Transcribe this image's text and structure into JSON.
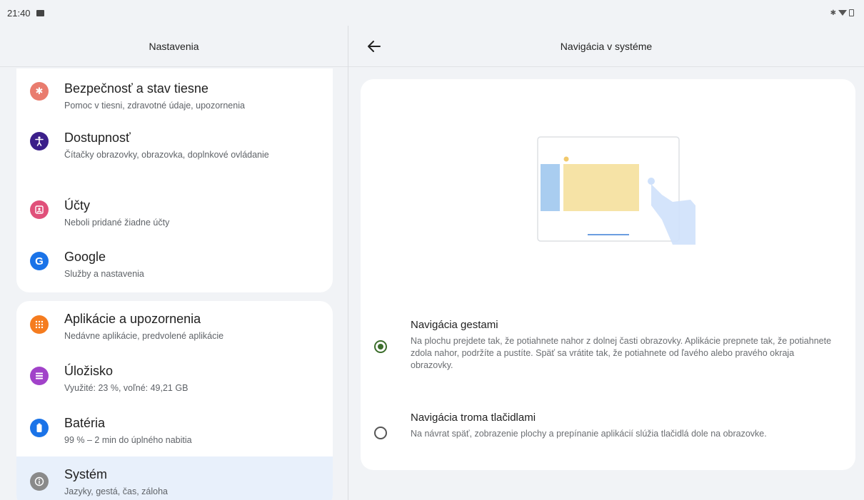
{
  "status_bar": {
    "time": "21:40"
  },
  "left": {
    "header": "Nastavenia",
    "items": [
      {
        "title": "Bezpečnosť a stav tiesne",
        "subtitle": "Pomoc v tiesni, zdravotné údaje, upozornenia",
        "icon": "emergency-icon",
        "color": "#e97c6e"
      },
      {
        "title": "Dostupnosť",
        "subtitle": "Čítačky obrazovky, obrazovka, doplnkové ovládanie",
        "icon": "accessibility-icon",
        "color": "#3b1f8a"
      },
      {
        "title": "Účty",
        "subtitle": "Neboli pridané žiadne účty",
        "icon": "accounts-icon",
        "color": "#e0507a"
      },
      {
        "title": "Google",
        "subtitle": "Služby a nastavenia",
        "icon": "google-icon",
        "color": "#1a73e8"
      },
      {
        "title": "Aplikácie a upozornenia",
        "subtitle": "Nedávne aplikácie, predvolené aplikácie",
        "icon": "apps-icon",
        "color": "#f57c1f"
      },
      {
        "title": "Úložisko",
        "subtitle": "Využité: 23 %, voľné: 49,21 GB",
        "icon": "storage-icon",
        "color": "#a142c9"
      },
      {
        "title": "Batéria",
        "subtitle": "99 % – 2 min do úplného nabitia",
        "icon": "battery-icon",
        "color": "#1a73e8"
      },
      {
        "title": "Systém",
        "subtitle": "Jazyky, gestá, čas, záloha",
        "icon": "system-icon",
        "color": "#8a8a8a"
      }
    ]
  },
  "right": {
    "header": "Navigácia v systéme",
    "options": [
      {
        "title": "Navigácia gestami",
        "desc": "Na plochu prejdete tak, že potiahnete nahor z dolnej časti obrazovky. Aplikácie prepnete tak, že potiahnete zdola nahor, podržíte a pustíte. Späť sa vrátite tak, že potiahnete od ľavého alebo pravého okraja obrazovky.",
        "selected": true
      },
      {
        "title": "Navigácia troma tlačidlami",
        "desc": "Na návrat späť, zobrazenie plochy a prepínanie aplikácií slúžia tlačidlá dole na obrazovke.",
        "selected": false
      }
    ]
  },
  "colors": {
    "radio_selected": "#3c6e2c",
    "selected_row_bg": "#e8f0fb"
  }
}
